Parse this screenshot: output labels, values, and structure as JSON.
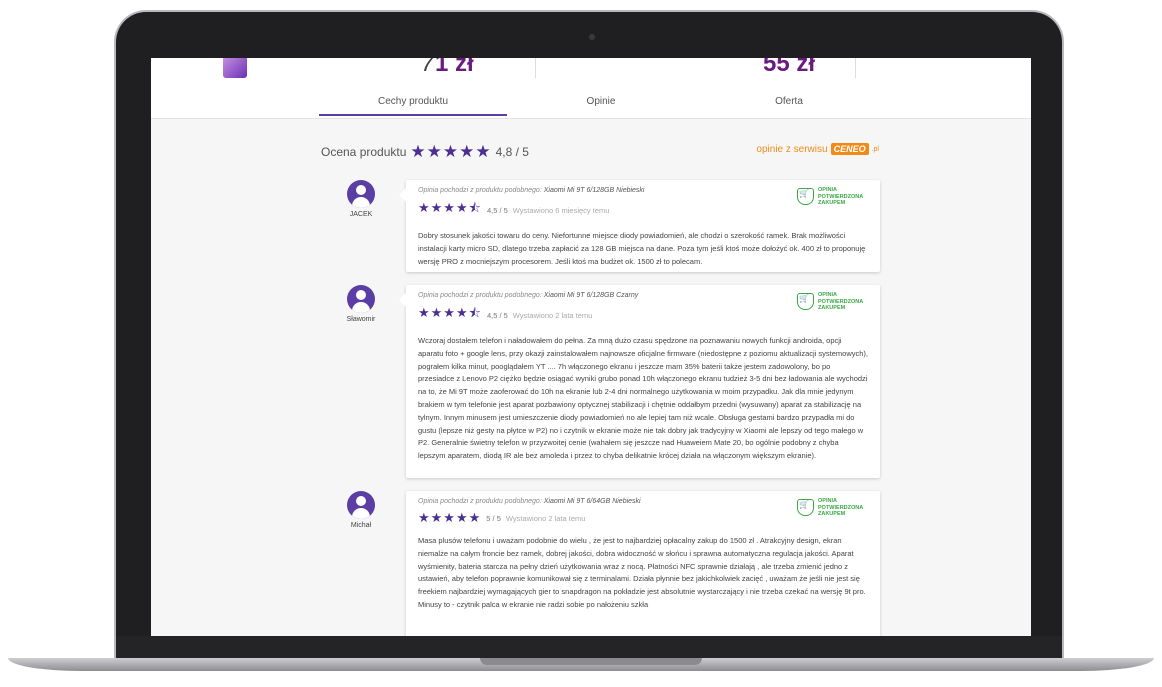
{
  "header": {
    "old_price": "7",
    "new_price": "1 zł",
    "price2": "55 zł",
    "tabs": [
      {
        "label": "Cechy produktu",
        "active": true
      },
      {
        "label": "Opinie",
        "active": false
      },
      {
        "label": "Oferta",
        "active": false
      }
    ]
  },
  "rating": {
    "label": "Ocena produktu",
    "stars": "★★★★★",
    "value": "4,8 / 5"
  },
  "ceneo": {
    "text": "opinie z serwisu",
    "logo": "CENEO",
    "suffix": ".pl"
  },
  "badge": {
    "line1": "OPINIA",
    "line2": "POTWIERDZONA",
    "line3": "ZAKUPEM"
  },
  "reviews": [
    {
      "user": "JACEK",
      "source_prefix": "Opinia pochodzi z produktu podobnego:",
      "source_product": "Xiaomi Mi 9T 6/128GB Niebieski",
      "stars": "★★★★⯪",
      "score": "4,5 / 5",
      "date": "Wystawiono 6 miesięcy temu",
      "text": "Dobry stosunek jakości towaru do ceny. Niefortunne miejsce diody powiadomień, ale chodzi o szerokość ramek. Brak możliwości instalacji karty micro SD, dlatego trzeba zapłacić za 128 GB miejsca na dane. Poza tym jeśli ktoś może dołożyć ok. 400 zł to proponuję wersję PRO z mocniejszym procesorem. Jeśli ktoś ma budżet ok. 1500 zł to polecam."
    },
    {
      "user": "Sławomir",
      "source_prefix": "Opinia pochodzi z produktu podobnego:",
      "source_product": "Xiaomi Mi 9T 6/128GB Czarny",
      "stars": "★★★★⯪",
      "score": "4,5 / 5",
      "date": "Wystawiono 2 lata temu",
      "text": "Wczoraj dostałem telefon i naładowałem do pełna. Za mną dużo czasu spędzone na poznawaniu nowych funkcji androida, opcji aparatu foto + google lens, przy okazji zainstalowałem najnowsze oficjalne firmware (niedostępne z poziomu aktualizacji systemowych), pograłem kilka minut, pooglądałem YT .... 7h włączonego ekranu i jeszcze mam 35% baterii także jestem zadowolony, bo po przesiadce z Lenovo P2 ciężko będzie osiągać wyniki grubo ponad 10h włączonego ekranu tudzież 3-5 dni bez ładowania ale wychodzi na to, że Mi 9T może zaoferować do 10h na ekranie lub 2-4 dni normalnego użytkowania w moim przypadku. Jak dla mnie jedynym brakiem w tym telefonie jest aparat pozbawiony optycznej stabilizacji i chętnie oddałbym przedni (wysuwany) aparat za stabilizację na tylnym. Innym minusem jest umieszczenie diody powiadomień no ale lepiej tam niż wcale. Obsługa gestami bardzo przypadła mi do gustu (lepsze niż gesty na płytce w P2) no i czytnik w ekranie może nie tak dobry jak tradycyjny w Xiaomi ale lepszy od tego małego w P2. Generalnie świetny telefon w przyzwoitej cenie (wahałem się jeszcze nad Huaweiem Mate 20, bo ogólnie podobny z chyba lepszym aparatem, diodą IR ale bez amoleda i przez to chyba delikatnie krócej działa na włączonym większym ekranie)."
    },
    {
      "user": "Michał",
      "source_prefix": "Opinia pochodzi z produktu podobnego:",
      "source_product": "Xiaomi Mi 9T 6/64GB Niebieski",
      "stars": "★★★★★",
      "score": "5 / 5",
      "date": "Wystawiono 2 lata temu",
      "text": "Masa plusów telefonu i uważam podobnie do wielu , że jest to najbardziej opłacalny zakup do 1500 zł . Atrakcyjny design, ekran niemalże na całym froncie bez ramek, dobrej jakości, dobra widoczność w słońcu i sprawna automatyczna regulacja jakości. Aparat wyśmienity, bateria starcza na pełny dzień użytkowania wraz z nocą. Płatności NFC sprawnie działają , ale trzeba zmienić jedno z ustawień, aby telefon poprawnie komunikował się z terminalami. Działa płynnie bez jakichkolwiek zacięć , uważam że jeśli nie jest się freekiem najbardziej wymagających gier to snapdragon na pokładzie jest absolutnie wystarczający i nie trzeba czekać na wersję 9t pro. Minusy to - czytnik palca w ekranie nie radzi sobie po nałożeniu szkła"
    }
  ]
}
